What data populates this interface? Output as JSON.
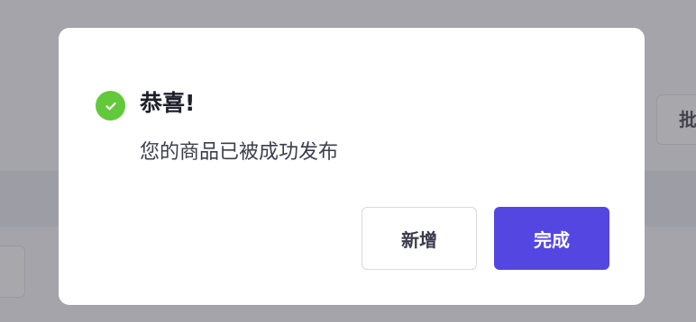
{
  "background": {
    "batch_button_label": "批"
  },
  "dialog": {
    "title": "恭喜!",
    "message": "您的商品已被成功发布",
    "icon": "check-circle-icon",
    "buttons": {
      "add_label": "新增",
      "done_label": "完成"
    }
  },
  "colors": {
    "success": "#62c93a",
    "primary": "#5446e0",
    "overlay": "rgba(80,79,86,0.45)"
  }
}
